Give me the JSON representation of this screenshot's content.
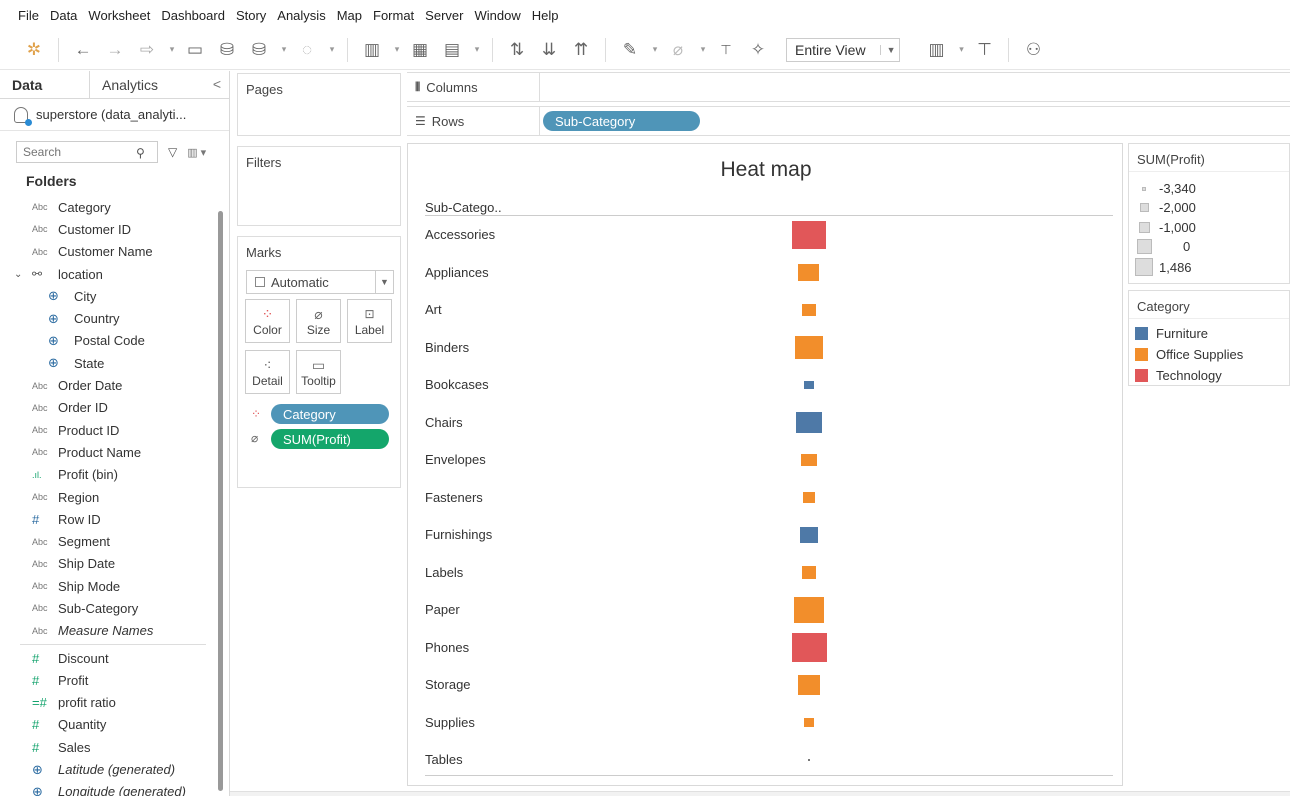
{
  "menu": [
    "File",
    "Data",
    "Worksheet",
    "Dashboard",
    "Story",
    "Analysis",
    "Map",
    "Format",
    "Server",
    "Window",
    "Help"
  ],
  "toolbar": {
    "view_mode": "Entire View"
  },
  "data_pane": {
    "tabs": [
      "Data",
      "Analytics"
    ],
    "datasource": "superstore (data_analyti...",
    "search_placeholder": "Search",
    "folders_title": "Folders",
    "dimensions": [
      {
        "label": "Category",
        "type": "Abc",
        "level": 0
      },
      {
        "label": "Customer ID",
        "type": "Abc",
        "level": 0
      },
      {
        "label": "Customer Name",
        "type": "Abc",
        "level": 0
      },
      {
        "label": "location",
        "type": "hierarchy",
        "level": 0
      },
      {
        "label": "City",
        "type": "geo",
        "level": 1
      },
      {
        "label": "Country",
        "type": "geo",
        "level": 1
      },
      {
        "label": "Postal Code",
        "type": "geo",
        "level": 1
      },
      {
        "label": "State",
        "type": "geo",
        "level": 1
      },
      {
        "label": "Order Date",
        "type": "Abc",
        "level": 0
      },
      {
        "label": "Order ID",
        "type": "Abc",
        "level": 0
      },
      {
        "label": "Product ID",
        "type": "Abc",
        "level": 0
      },
      {
        "label": "Product Name",
        "type": "Abc",
        "level": 0
      },
      {
        "label": "Profit (bin)",
        "type": "bin",
        "level": 0
      },
      {
        "label": "Region",
        "type": "Abc",
        "level": 0
      },
      {
        "label": "Row ID",
        "type": "#",
        "level": 0
      },
      {
        "label": "Segment",
        "type": "Abc",
        "level": 0
      },
      {
        "label": "Ship Date",
        "type": "Abc",
        "level": 0
      },
      {
        "label": "Ship Mode",
        "type": "Abc",
        "level": 0
      },
      {
        "label": "Sub-Category",
        "type": "Abc",
        "level": 0
      },
      {
        "label": "Measure Names",
        "type": "Abc",
        "level": 0,
        "italic": true
      }
    ],
    "measures": [
      {
        "label": "Discount",
        "type": "#"
      },
      {
        "label": "Profit",
        "type": "#"
      },
      {
        "label": "profit ratio",
        "type": "=#"
      },
      {
        "label": "Quantity",
        "type": "#"
      },
      {
        "label": "Sales",
        "type": "#"
      },
      {
        "label": "Latitude (generated)",
        "type": "geo",
        "italic": true
      },
      {
        "label": "Longitude (generated)",
        "type": "geo",
        "italic": true
      }
    ]
  },
  "cards": {
    "pages": "Pages",
    "filters": "Filters",
    "marks": "Marks",
    "mark_type": "Automatic",
    "mark_buttons": [
      "Color",
      "Size",
      "Label",
      "Detail",
      "Tooltip"
    ],
    "pills": [
      "Category",
      "SUM(Profit)"
    ]
  },
  "shelves": {
    "columns_label": "Columns",
    "rows_label": "Rows",
    "rows_pill": "Sub-Category"
  },
  "viz": {
    "title": "Heat map",
    "column_header": "Sub-Catego.."
  },
  "legends": {
    "size_title": "SUM(Profit)",
    "size_items": [
      "-3,340",
      "-2,000",
      "-1,000",
      "0",
      "1,486"
    ],
    "color_title": "Category",
    "color_items": [
      {
        "label": "Furniture",
        "color": "#4e79a7"
      },
      {
        "label": "Office Supplies",
        "color": "#f28e2b"
      },
      {
        "label": "Technology",
        "color": "#e15759"
      }
    ]
  },
  "chart_data": {
    "type": "heatmap",
    "title": "Heat map",
    "row_field": "Sub-Category",
    "size_field": "SUM(Profit)",
    "color_field": "Category",
    "rows": [
      {
        "name": "Accessories",
        "category": "Technology",
        "profit": 41937
      },
      {
        "name": "Appliances",
        "category": "Office Supplies",
        "profit": 18138
      },
      {
        "name": "Art",
        "category": "Office Supplies",
        "profit": 6528
      },
      {
        "name": "Binders",
        "category": "Office Supplies",
        "profit": 30222
      },
      {
        "name": "Bookcases",
        "category": "Furniture",
        "profit": -3473
      },
      {
        "name": "Chairs",
        "category": "Furniture",
        "profit": 26590
      },
      {
        "name": "Envelopes",
        "category": "Office Supplies",
        "profit": 6964
      },
      {
        "name": "Fasteners",
        "category": "Office Supplies",
        "profit": 950
      },
      {
        "name": "Furnishings",
        "category": "Furniture",
        "profit": 13059
      },
      {
        "name": "Labels",
        "category": "Office Supplies",
        "profit": 5546
      },
      {
        "name": "Paper",
        "category": "Office Supplies",
        "profit": 34054
      },
      {
        "name": "Phones",
        "category": "Technology",
        "profit": 44516
      },
      {
        "name": "Storage",
        "category": "Office Supplies",
        "profit": 21279
      },
      {
        "name": "Supplies",
        "category": "Office Supplies",
        "profit": -1189
      },
      {
        "name": "Tables",
        "category": "Furniture",
        "profit": -17725
      }
    ]
  }
}
